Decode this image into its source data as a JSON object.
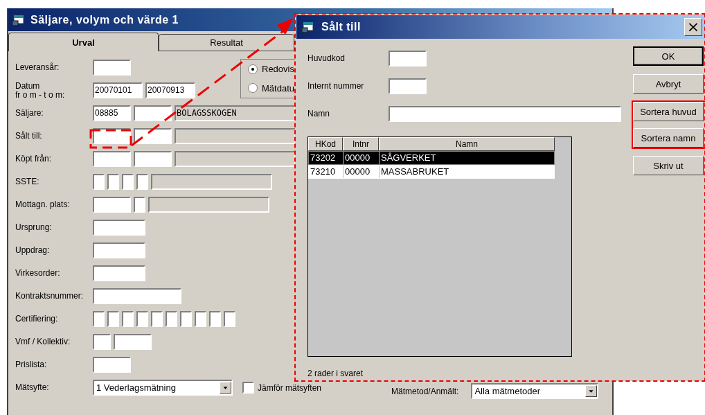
{
  "window": {
    "title": "Säljare, volym och värde 1"
  },
  "tabs": [
    {
      "label": "Urval",
      "selected": true
    },
    {
      "label": "Resultat",
      "selected": false
    }
  ],
  "form": [
    {
      "label": "Leveransår:",
      "fields": [
        {
          "kind": "small"
        }
      ]
    },
    {
      "label": "Datum",
      "label2": "fr o m - t o m:",
      "fields": [
        {
          "kind": "date",
          "value": "20070101"
        },
        {
          "kind": "date",
          "value": "20070913"
        }
      ]
    },
    {
      "label": "Säljare:",
      "fields": [
        {
          "kind": "small",
          "value": "08885"
        },
        {
          "kind": "small"
        },
        {
          "kind": "name",
          "value": "BOLAGSSKOGEN"
        }
      ]
    },
    {
      "label": "Sålt till:",
      "fields": [
        {
          "kind": "small"
        },
        {
          "kind": "small"
        },
        {
          "kind": "name"
        }
      ]
    },
    {
      "label": "Köpt från:",
      "fields": [
        {
          "kind": "small"
        },
        {
          "kind": "small"
        },
        {
          "kind": "name"
        }
      ]
    },
    {
      "label": "SSTE:",
      "fields": [
        {
          "kind": "digit"
        },
        {
          "kind": "digit"
        },
        {
          "kind": "digit"
        },
        {
          "kind": "digit"
        },
        {
          "kind": "name"
        }
      ]
    },
    {
      "label": "Mottagn. plats:",
      "fields": [
        {
          "kind": "small"
        },
        {
          "kind": "digit"
        },
        {
          "kind": "name"
        }
      ]
    },
    {
      "label": "Ursprung:",
      "fields": [
        {
          "kind": "medium"
        }
      ]
    },
    {
      "label": "Uppdrag:",
      "fields": [
        {
          "kind": "medium"
        }
      ]
    },
    {
      "label": "Virkesorder:",
      "fields": [
        {
          "kind": "medium"
        }
      ]
    },
    {
      "label": "Kontraktsnummer:",
      "fields": [
        {
          "kind": "wide"
        }
      ]
    },
    {
      "label": "Certifiering:",
      "fields": [
        {
          "kind": "digit"
        },
        {
          "kind": "digit"
        },
        {
          "kind": "digit"
        },
        {
          "kind": "digit"
        },
        {
          "kind": "digit"
        },
        {
          "kind": "digit"
        },
        {
          "kind": "digit"
        },
        {
          "kind": "digit"
        },
        {
          "kind": "digit"
        },
        {
          "kind": "digit"
        }
      ]
    },
    {
      "label": "Vmf / Kollektiv:",
      "fields": [
        {
          "kind": "digit2"
        },
        {
          "kind": "small"
        }
      ]
    },
    {
      "label": "Prislista:",
      "fields": [
        {
          "kind": "small"
        }
      ]
    },
    {
      "label": "Mätsyfte:",
      "fields": [
        {
          "kind": "combo",
          "value": "1 Vederlagsmätning"
        }
      ],
      "checkbox": {
        "label": "Jämför mätsyften",
        "checked": false
      }
    }
  ],
  "radios": [
    {
      "label": "Redovis",
      "selected": true
    },
    {
      "label": "Mätdatu",
      "selected": false
    }
  ],
  "measure": {
    "label": "Mätmetod/Anmält:",
    "value": "Alla mätmetoder"
  },
  "dialog": {
    "title": "Sålt till",
    "close": "×",
    "fields": [
      {
        "label": "Huvudkod",
        "kind": "small"
      },
      {
        "label": "Internt nummer",
        "kind": "small"
      },
      {
        "label": "Namn",
        "kind": "long"
      }
    ],
    "buttons": [
      {
        "label": "OK",
        "default": true,
        "highlighted": false
      },
      {
        "label": "Avbryt",
        "default": false,
        "highlighted": false
      },
      {
        "label": "Sortera huvud",
        "default": false,
        "highlighted": true
      },
      {
        "label": "Sortera namn",
        "default": false,
        "highlighted": true
      },
      {
        "label": "Skriv ut",
        "default": false,
        "highlighted": false
      }
    ],
    "columns": [
      "HKod",
      "Intnr",
      "Namn"
    ],
    "rows": [
      {
        "cells": [
          "73202",
          "00000",
          "SÅGVERKET"
        ],
        "selected": true
      },
      {
        "cells": [
          "73210",
          "00000",
          "MASSABRUKET"
        ],
        "selected": false
      }
    ],
    "status": "2 rader i svaret"
  }
}
